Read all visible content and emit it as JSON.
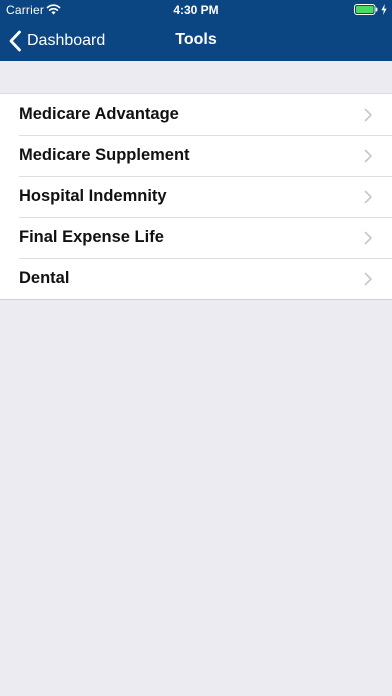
{
  "status_bar": {
    "carrier": "Carrier",
    "time": "4:30 PM",
    "wifi_icon": "wifi-icon",
    "battery_icon": "battery-icon",
    "charging_icon": "bolt-icon"
  },
  "nav": {
    "back_label": "Dashboard",
    "back_icon": "chevron-left-icon",
    "title": "Tools"
  },
  "tools": {
    "items": [
      {
        "label": "Medicare Advantage"
      },
      {
        "label": "Medicare Supplement"
      },
      {
        "label": "Hospital Indemnity"
      },
      {
        "label": "Final Expense Life"
      },
      {
        "label": "Dental"
      }
    ],
    "row_icon": "chevron-right-icon"
  },
  "colors": {
    "nav_background": "#0b4683",
    "page_background": "#ecebf2",
    "battery_fill": "#4cd964"
  }
}
